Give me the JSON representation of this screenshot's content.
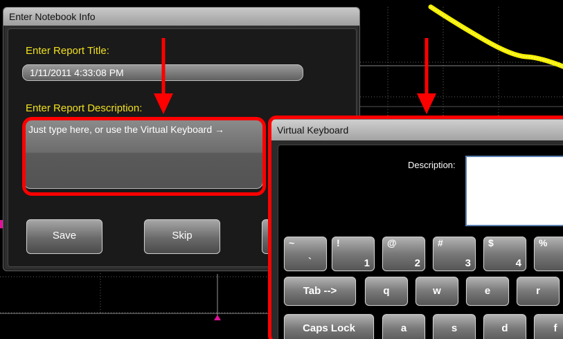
{
  "notebook_dialog": {
    "title": "Enter Notebook Info",
    "report_title_label": "Enter Report Title:",
    "report_title_value": "1/11/2011 4:33:08 PM",
    "report_description_label": "Enter Report Description:",
    "report_description_value": "Just type here, or use the Virtual Keyboard →",
    "buttons": {
      "save": "Save",
      "skip": "Skip"
    }
  },
  "virtual_keyboard": {
    "title": "Virtual Keyboard",
    "description_label": "Description:",
    "description_value": "",
    "rows": {
      "numbers": [
        {
          "top": "~",
          "bottom": "`"
        },
        {
          "top": "!",
          "bottom": "1"
        },
        {
          "top": "@",
          "bottom": "2"
        },
        {
          "top": "#",
          "bottom": "3"
        },
        {
          "top": "$",
          "bottom": "4"
        },
        {
          "top": "%",
          "bottom": ""
        }
      ],
      "qwerty": [
        "Tab -->",
        "q",
        "w",
        "e",
        "r"
      ],
      "home": [
        "Caps Lock",
        "a",
        "s",
        "d",
        "f"
      ]
    }
  },
  "colors": {
    "annotation_red": "#ff0000",
    "label_yellow": "#f0e020",
    "trace_yellow": "#f5f000",
    "marker_magenta": "#e0109a"
  }
}
